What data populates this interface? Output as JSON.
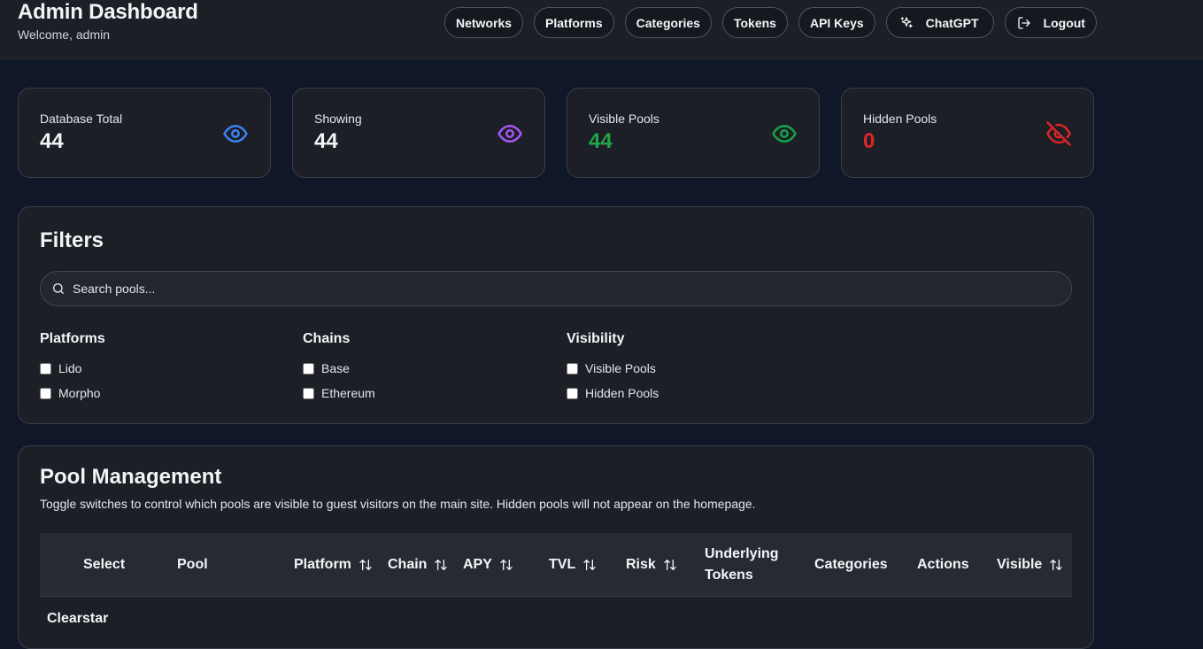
{
  "header": {
    "title": "Admin Dashboard",
    "welcome": "Welcome, admin",
    "nav": {
      "networks": "Networks",
      "platforms": "Platforms",
      "categories": "Categories",
      "tokens": "Tokens",
      "api_keys": "API Keys",
      "chatgpt": "ChatGPT",
      "logout": "Logout"
    }
  },
  "stats": {
    "database_total": {
      "label": "Database Total",
      "value": "44",
      "icon": "eye-icon",
      "color": "#3b82f6"
    },
    "showing": {
      "label": "Showing",
      "value": "44",
      "icon": "eye-icon",
      "color": "#a855f7"
    },
    "visible": {
      "label": "Visible Pools",
      "value": "44",
      "icon": "eye-icon",
      "color": "#22c55e"
    },
    "hidden": {
      "label": "Hidden Pools",
      "value": "0",
      "icon": "eye-off-icon",
      "color": "#dc2626"
    }
  },
  "filters": {
    "title": "Filters",
    "search_placeholder": "Search pools...",
    "platforms": {
      "title": "Platforms",
      "options": [
        "Lido",
        "Morpho"
      ]
    },
    "chains": {
      "title": "Chains",
      "options": [
        "Base",
        "Ethereum"
      ]
    },
    "visibility": {
      "title": "Visibility",
      "options": [
        "Visible Pools",
        "Hidden Pools"
      ]
    }
  },
  "pool_management": {
    "title": "Pool Management",
    "description": "Toggle switches to control which pools are visible to guest visitors on the main site. Hidden pools will not appear on the homepage.",
    "columns": {
      "select": "Select",
      "pool": "Pool",
      "platform": "Platform",
      "chain": "Chain",
      "apy": "APY",
      "tvl": "TVL",
      "risk": "Risk",
      "underlying_line1": "Underlying",
      "underlying_line2": "Tokens",
      "categories": "Categories",
      "actions": "Actions",
      "visible": "Visible"
    },
    "first_row_label": "Clearstar"
  },
  "colors": {
    "background": "#0f1729",
    "card": "#1c1f26",
    "border": "#3a3f4a"
  }
}
